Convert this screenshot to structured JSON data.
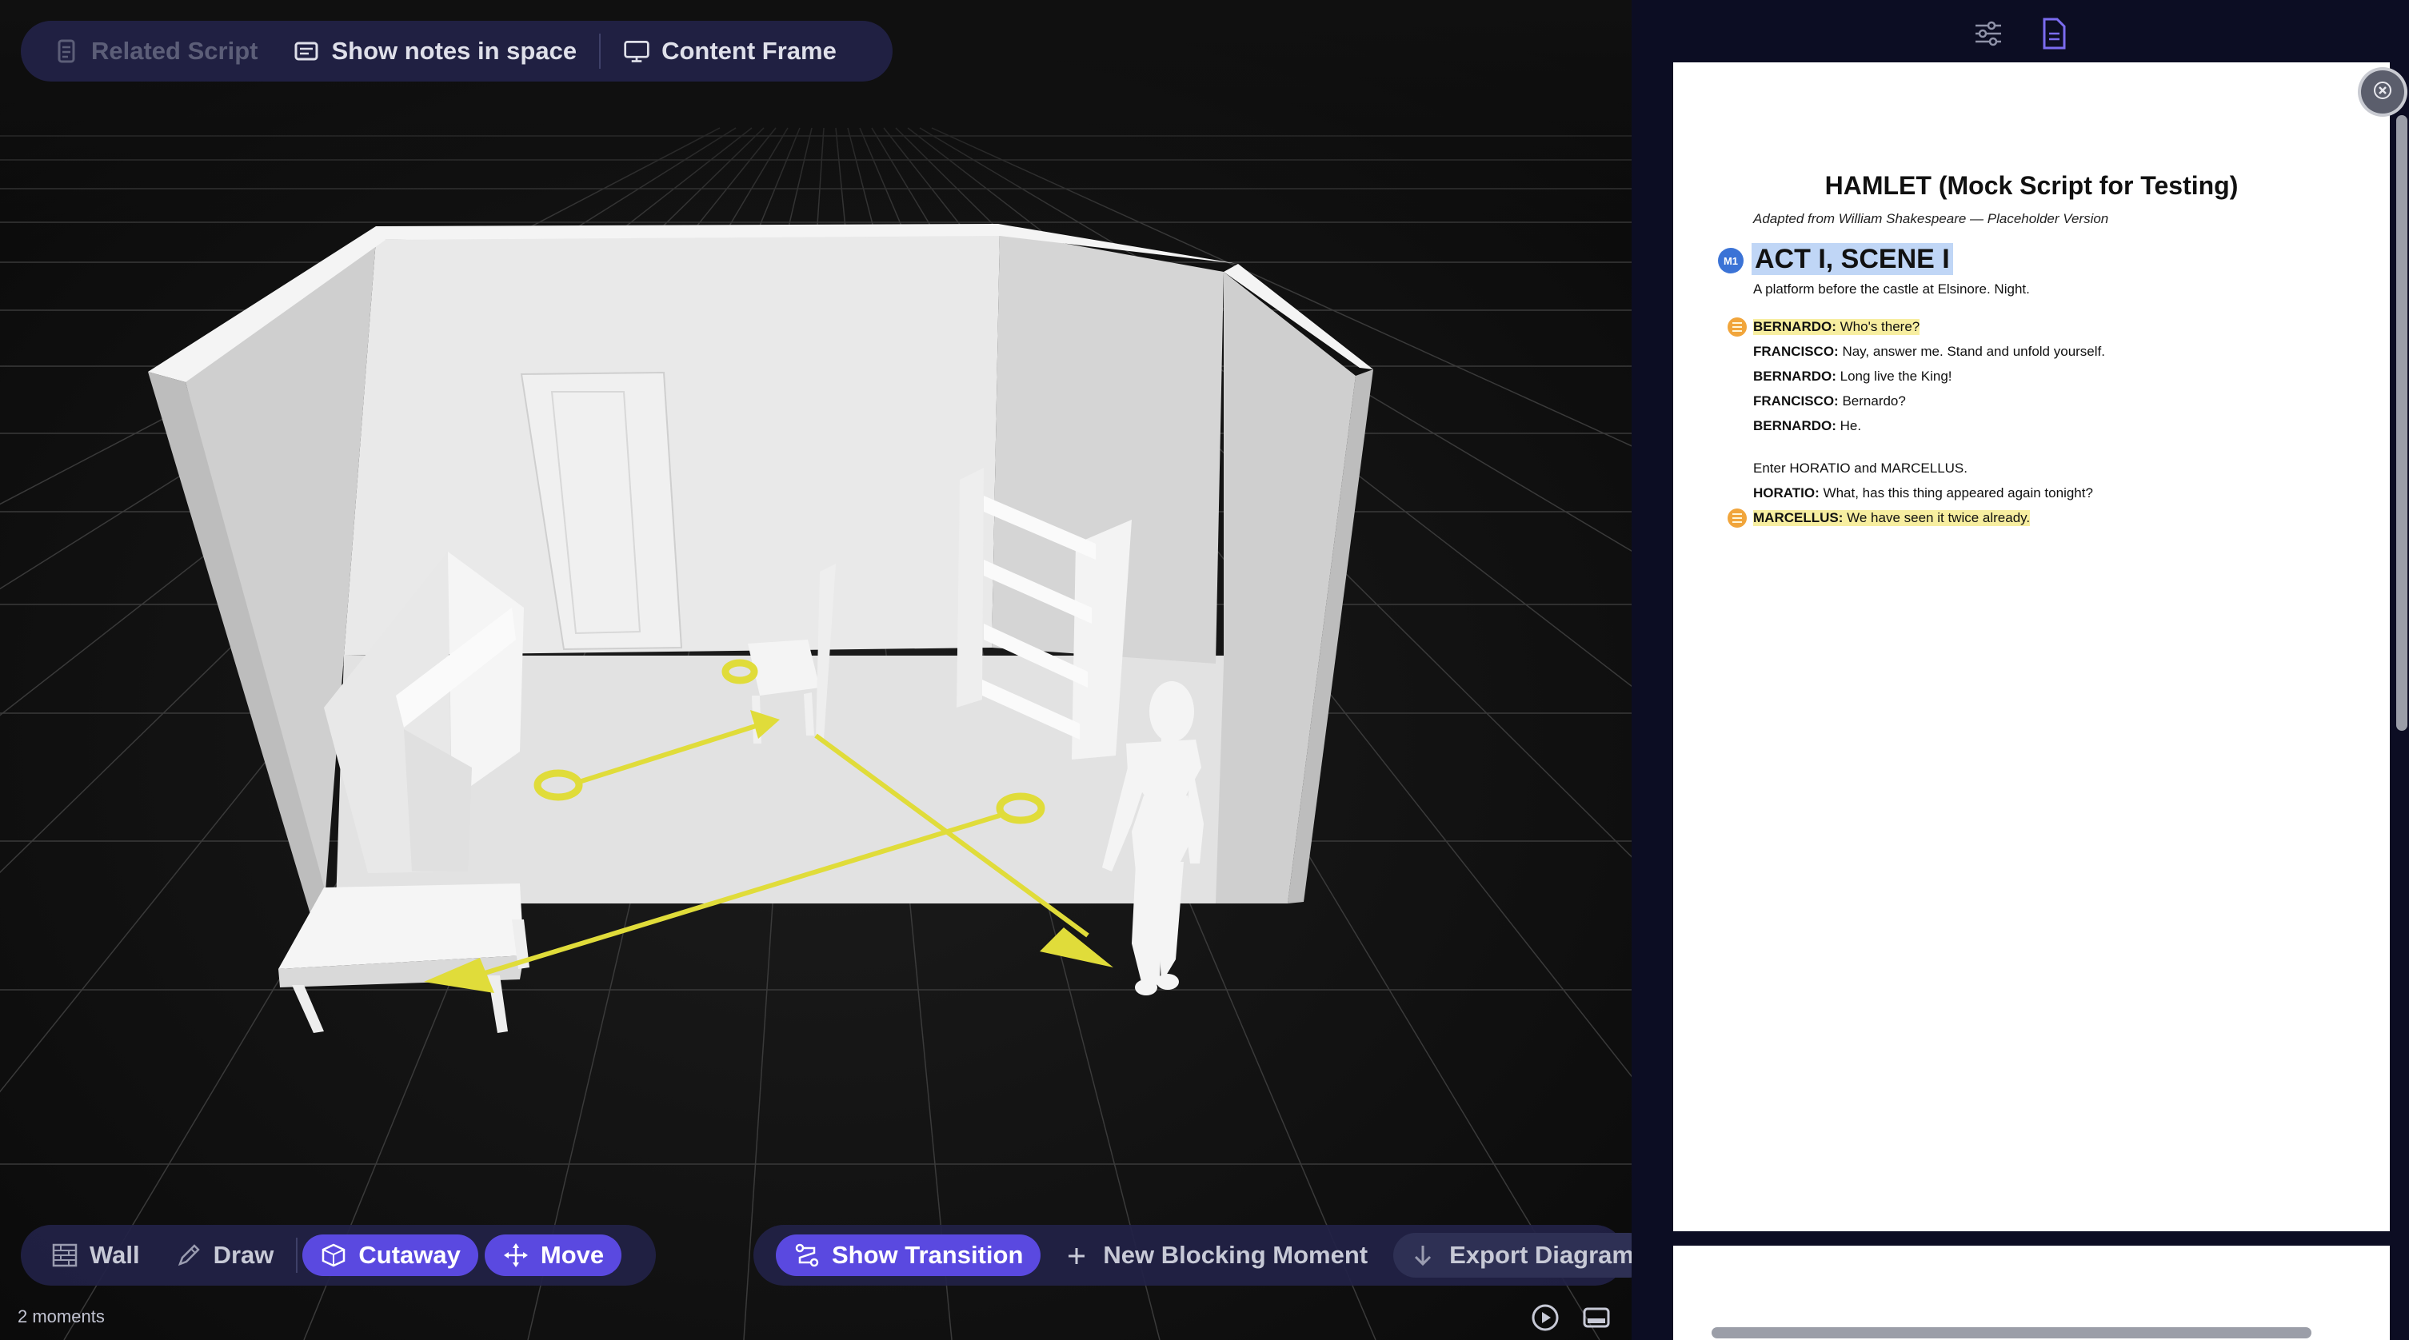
{
  "top_toolbar": {
    "related_script": "Related Script",
    "show_notes": "Show notes in space",
    "content_frame": "Content Frame"
  },
  "bottom_left_toolbar": {
    "wall": "Wall",
    "draw": "Draw",
    "cutaway": "Cutaway",
    "move": "Move"
  },
  "bottom_right_toolbar": {
    "show_transition": "Show Transition",
    "new_blocking_moment": "New Blocking Moment",
    "export_diagram": "Export Diagram"
  },
  "status": {
    "moments_count": "2 moments"
  },
  "icons": {
    "related_script": "document-icon",
    "show_notes": "notes-icon",
    "content_frame": "monitor-icon",
    "wall": "brick-wall-icon",
    "draw": "pencil-icon",
    "cutaway": "cutaway-box-icon",
    "move": "move-arrows-icon",
    "show_transition": "transition-icon",
    "new_blocking_moment": "plus-icon",
    "export_diagram": "download-arrow-icon",
    "play": "play-icon",
    "panel": "panel-toggle-icon",
    "settings": "sliders-icon",
    "script_tab": "document-icon",
    "close": "close-icon"
  },
  "script": {
    "title": "HAMLET (Mock Script for Testing)",
    "subtitle": "Adapted from William Shakespeare — Placeholder Version",
    "moment_badge": "M1",
    "scene_heading": "ACT I, SCENE I",
    "setting": "A platform before the castle at Elsinore. Night.",
    "lines": [
      {
        "speaker": "BERNARDO:",
        "text": "Who's there?"
      },
      {
        "speaker": "FRANCISCO:",
        "text": "Nay, answer me. Stand and unfold yourself."
      },
      {
        "speaker": "BERNARDO:",
        "text": "Long live the King!"
      },
      {
        "speaker": "FRANCISCO:",
        "text": "Bernardo?"
      },
      {
        "speaker": "BERNARDO:",
        "text": "He."
      }
    ],
    "stage_direction": "Enter HORATIO and MARCELLUS.",
    "lines2": [
      {
        "speaker": "HORATIO:",
        "text": "What, has this thing appeared again tonight?"
      },
      {
        "speaker": "MARCELLUS:",
        "text": "We have seen it twice already."
      }
    ]
  },
  "colors": {
    "accent": "#5a49e0",
    "path": "#e0dc3a",
    "highlight": "#f7eea0",
    "moment_badge": "#3b73d6",
    "note_badge": "#f1a53b"
  }
}
